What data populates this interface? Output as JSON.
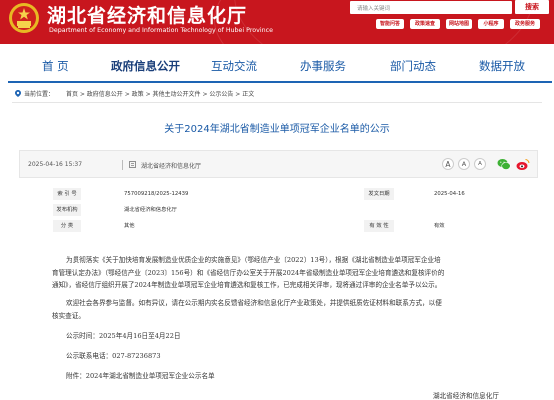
{
  "header": {
    "site_title": "湖北省经济和信息化厅",
    "site_subtitle": "Department of Economy and Information Technology of Hubei Province",
    "search_placeholder": "请输入关键词",
    "search_button": "搜索",
    "quick_links": [
      "智能问答",
      "政策速查",
      "网站地图",
      "小程序",
      "政务服务"
    ],
    "colors": {
      "brand_red": "#c8161e",
      "nav_blue": "#1a5aa6"
    }
  },
  "nav": {
    "items": [
      "首 页",
      "政府信息公开",
      "互动交流",
      "办事服务",
      "部门动态",
      "数据开放"
    ],
    "active": "政府信息公开"
  },
  "breadcrumb": {
    "prefix": "当前位置：",
    "items": [
      "首页",
      "政府信息公开",
      "政策",
      "其他主动公开文件",
      "公示公告",
      "正文"
    ],
    "separator": " > "
  },
  "article": {
    "title": "关于2024年湖北省制造业单项冠军企业名单的公示",
    "date": "2025-04-16 15:37",
    "source": "湖北省经济和信息化厅",
    "font_buttons": [
      "A",
      "A",
      "A"
    ]
  },
  "info_table": {
    "index_label": "索 引 号",
    "index_value": "757009218/2025-12439",
    "release_date_label": "发文日期",
    "release_date_value": "2025-04-16",
    "issuer_label": "发布机构",
    "issuer_value": "湖北省经济和信息化厅",
    "category_label": "分 类",
    "category_value": "其他",
    "validity_label": "有 效 性",
    "validity_value": "有效"
  },
  "body": {
    "p1_l1": "为贯彻落实《关于加快培育发展制造业优质企业的实施意见》（鄂经信产业〔2022〕13号），根据《湖北省制造业单项冠军企业培",
    "p1_l2": "育管理认定办法》（鄂经信产业〔2023〕156号）和《省经信厅办公室关于开展2024年省级制造业单项冠军企业培育遴选和复核评价的",
    "p1_l3": "通知》，省经信厅组织开展了2024年制造业单项冠军企业培育遴选和复核工作，已完成相关评审，现将通过评审的企业名单予以公示。",
    "p2_l1": "欢迎社会各界参与监督。如有异议，请在公示期内实名反馈省经济和信息化厅产业政策处，并提供纸质佐证材料和联系方式，以便",
    "p2_l2": "核实查证。",
    "period": "公示时间：2025年4月16日至4月22日",
    "phone": "公示联系电话：027-87236873",
    "attachment": "附件：2024年湖北省制造业单项冠军企业公示名单",
    "signature": "湖北省经济和信息化厅"
  }
}
